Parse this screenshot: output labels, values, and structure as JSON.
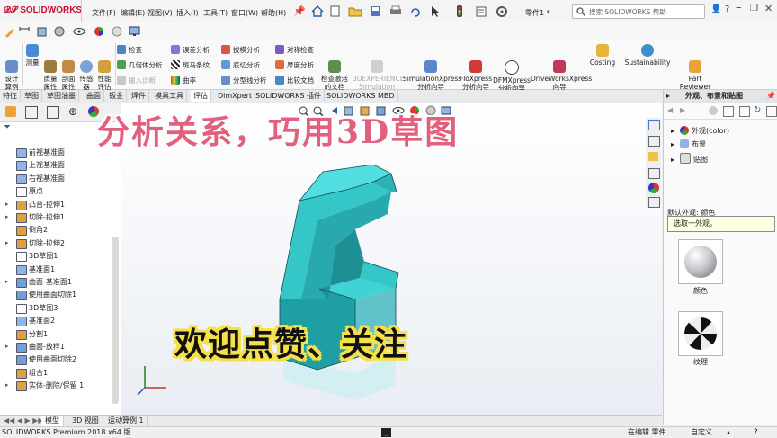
{
  "app": {
    "logo_text": "SOLIDWORKS",
    "document_name": "零件1 *",
    "search_placeholder": "搜索 SOLIDWORKS 帮助"
  },
  "menu": [
    "文件(F)",
    "编辑(E)",
    "视图(V)",
    "插入(I)",
    "工具(T)",
    "窗口(W)",
    "帮助(H)"
  ],
  "ribbon": {
    "design_study": "设计\n算例",
    "measure": "测量",
    "mass_props": "质量\n属性",
    "section_props": "剖面\n属性",
    "sensor": "传感\n器",
    "performance": "性能\n评估",
    "check": "检查",
    "geometry_analysis": "几何体分析",
    "import_diagnostics": "输入诊断",
    "interference": "误差分析",
    "zebra": "斑马条纹",
    "curvature": "曲率",
    "draft_analysis": "拔模分析",
    "undercut": "底切分析",
    "parting_line": "分型线分析",
    "symmetry_check": "对称检查",
    "thickness": "厚度分析",
    "compare": "比较文档",
    "check_active": "检查激活\n的文档",
    "sim_connector": "3DEXPERIENCE\nSimulation\nConnector",
    "simxpress": "SimulationXpress\n分析向导",
    "floxpress": "FloXpress\n分析向导",
    "dfmxpress": "DFMXpress\n分析向导",
    "driveworks": "DriveWorksXpress\n向导",
    "costing": "Costing",
    "sustainability": "Sustainability",
    "part_reviewer": "Part\nReviewer"
  },
  "tabs": [
    "特征",
    "草图",
    "草图油墨",
    "曲面",
    "钣金",
    "焊件",
    "模具工具",
    "评估",
    "DimXpert",
    "SOLIDWORKS 插件",
    "SOLIDWORKS MBD"
  ],
  "active_tab": "评估",
  "tree": [
    {
      "label": "前视基准面",
      "icon": "plane",
      "expand": ""
    },
    {
      "label": "上视基准面",
      "icon": "plane",
      "expand": ""
    },
    {
      "label": "右视基准面",
      "icon": "plane",
      "expand": ""
    },
    {
      "label": "原点",
      "icon": "origin",
      "expand": ""
    },
    {
      "label": "凸台-拉伸1",
      "icon": "feature",
      "expand": "▸"
    },
    {
      "label": "切除-拉伸1",
      "icon": "feature",
      "expand": "▸"
    },
    {
      "label": "倒角2",
      "icon": "feature",
      "expand": ""
    },
    {
      "label": "切除-拉伸2",
      "icon": "feature",
      "expand": "▸"
    },
    {
      "label": "3D草图1",
      "icon": "sketch",
      "expand": ""
    },
    {
      "label": "基准面1",
      "icon": "plane",
      "expand": ""
    },
    {
      "label": "曲面-基准面1",
      "icon": "surface",
      "expand": "▸"
    },
    {
      "label": "使用曲面切除1",
      "icon": "surface",
      "expand": ""
    },
    {
      "label": "3D草图3",
      "icon": "sketch",
      "expand": ""
    },
    {
      "label": "基准面2",
      "icon": "plane",
      "expand": ""
    },
    {
      "label": "分割1",
      "icon": "feature",
      "expand": ""
    },
    {
      "label": "曲面-放样1",
      "icon": "surface",
      "expand": "▸"
    },
    {
      "label": "使用曲面切除2",
      "icon": "surface",
      "expand": ""
    },
    {
      "label": "组合1",
      "icon": "feature",
      "expand": ""
    },
    {
      "label": "实体-删除/保留 1",
      "icon": "feature",
      "expand": "▸"
    }
  ],
  "overlay": {
    "top_title": "分析关系，巧用3D草图",
    "bottom_title": "欢迎点赞、关注"
  },
  "task_pane": {
    "title": "外观、布景和贴图",
    "items": [
      "外观(color)",
      "布景",
      "贴图"
    ],
    "default_label": "默认外观: 颜色",
    "tooltip": "选取一外观。",
    "swatch1_label": "颜色",
    "swatch2_label": "纹理"
  },
  "bottom_tabs": [
    "模型",
    "3D 视图",
    "运动算例 1"
  ],
  "status": {
    "left": "SOLIDWORKS Premium 2018 x64 版",
    "editing": "在编辑 零件",
    "custom": "自定义"
  },
  "colors": {
    "part_teal": "#35c6c8",
    "part_dark": "#1f9ea4",
    "overlay_pink": "#e0607e",
    "overlay_yellow": "#f6e04a"
  }
}
